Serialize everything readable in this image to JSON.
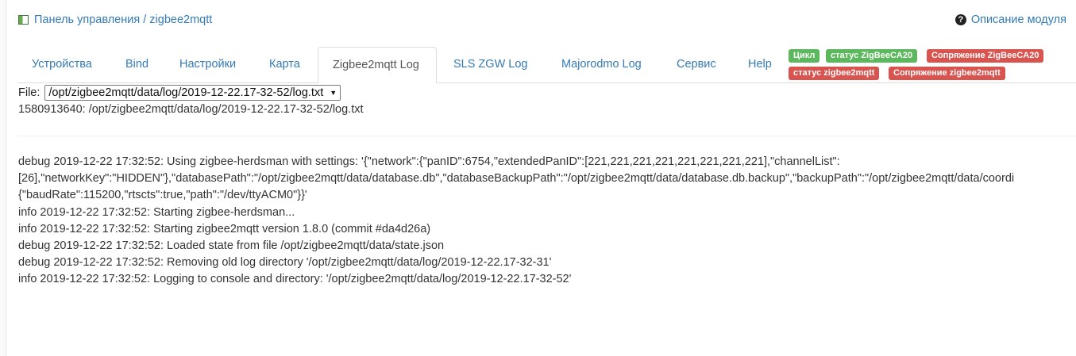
{
  "breadcrumb": {
    "text": "Панель управления / zigbee2mqtt",
    "icon": "module-icon"
  },
  "help": {
    "label": "Описание модуля",
    "icon": "question-circle-icon"
  },
  "tabs": [
    {
      "label": "Устройства"
    },
    {
      "label": "Bind"
    },
    {
      "label": "Настройки"
    },
    {
      "label": "Карта"
    },
    {
      "label": "Zigbee2mqtt Log",
      "active": true
    },
    {
      "label": "SLS ZGW Log"
    },
    {
      "label": "Majorodmo Log"
    },
    {
      "label": "Сервис"
    },
    {
      "label": "Help"
    }
  ],
  "badges": [
    {
      "label": "Цикл",
      "color": "#5cb85c"
    },
    {
      "label": "статус ZigBeeCA20",
      "color": "#5cb85c"
    },
    {
      "label": "Сопряжение ZigBeeCA20",
      "color": "#d9534f"
    },
    {
      "label": "статус zigbee2mqtt",
      "color": "#d9534f"
    },
    {
      "label": "Сопряжение zigbee2mqtt",
      "color": "#d9534f"
    }
  ],
  "file": {
    "label": "File:",
    "selected": "/opt/zigbee2mqtt/data/log/2019-12-22.17-32-52/log.txt",
    "path_line": "1580913640: /opt/zigbee2mqtt/data/log/2019-12-22.17-32-52/log.txt"
  },
  "log_lines": [
    "debug 2019-12-22 17:32:52: Using zigbee-herdsman with settings: '{\"network\":{\"panID\":6754,\"extendedPanID\":[221,221,221,221,221,221,221,221],\"channelList\":",
    "[26],\"networkKey\":\"HIDDEN\"},\"databasePath\":\"/opt/zigbee2mqtt/data/database.db\",\"databaseBackupPath\":\"/opt/zigbee2mqtt/data/database.db.backup\",\"backupPath\":\"/opt/zigbee2mqtt/data/coordi",
    "{\"baudRate\":115200,\"rtscts\":true,\"path\":\"/dev/ttyACM0\"}}'",
    "info 2019-12-22 17:32:52: Starting zigbee-herdsman...",
    "info 2019-12-22 17:32:52: Starting zigbee2mqtt version 1.8.0 (commit #da4d26a)",
    "debug 2019-12-22 17:32:52: Loaded state from file /opt/zigbee2mqtt/data/state.json",
    "debug 2019-12-22 17:32:52: Removing old log directory '/opt/zigbee2mqtt/data/log/2019-12-22.17-32-31'",
    "info 2019-12-22 17:32:52: Logging to console and directory: '/opt/zigbee2mqtt/data/log/2019-12-22.17-32-52'"
  ]
}
